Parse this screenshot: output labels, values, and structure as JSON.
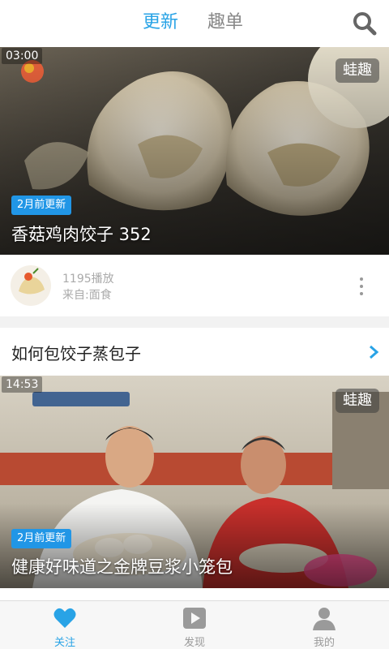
{
  "header": {
    "tabs": [
      {
        "label": "更新",
        "active": true
      },
      {
        "label": "趣单",
        "active": false
      }
    ],
    "search_icon": "search-icon",
    "accent_color": "#29a3e6"
  },
  "feed": [
    {
      "duration": "03:00",
      "brand_badge": "蛙趣",
      "age_badge": "2月前更新",
      "title": "香菇鸡肉饺子 352",
      "plays": "1195播放",
      "source": "来自:面食"
    },
    {
      "section_title": "如何包饺子蒸包子",
      "duration": "14:53",
      "brand_badge": "蛙趣",
      "age_badge": "2月前更新",
      "title": "健康好味道之金牌豆浆小笼包"
    }
  ],
  "bottom_nav": [
    {
      "label": "关注",
      "icon": "heart-icon",
      "active": true
    },
    {
      "label": "发现",
      "icon": "play-icon",
      "active": false
    },
    {
      "label": "我的",
      "icon": "user-icon",
      "active": false
    }
  ]
}
